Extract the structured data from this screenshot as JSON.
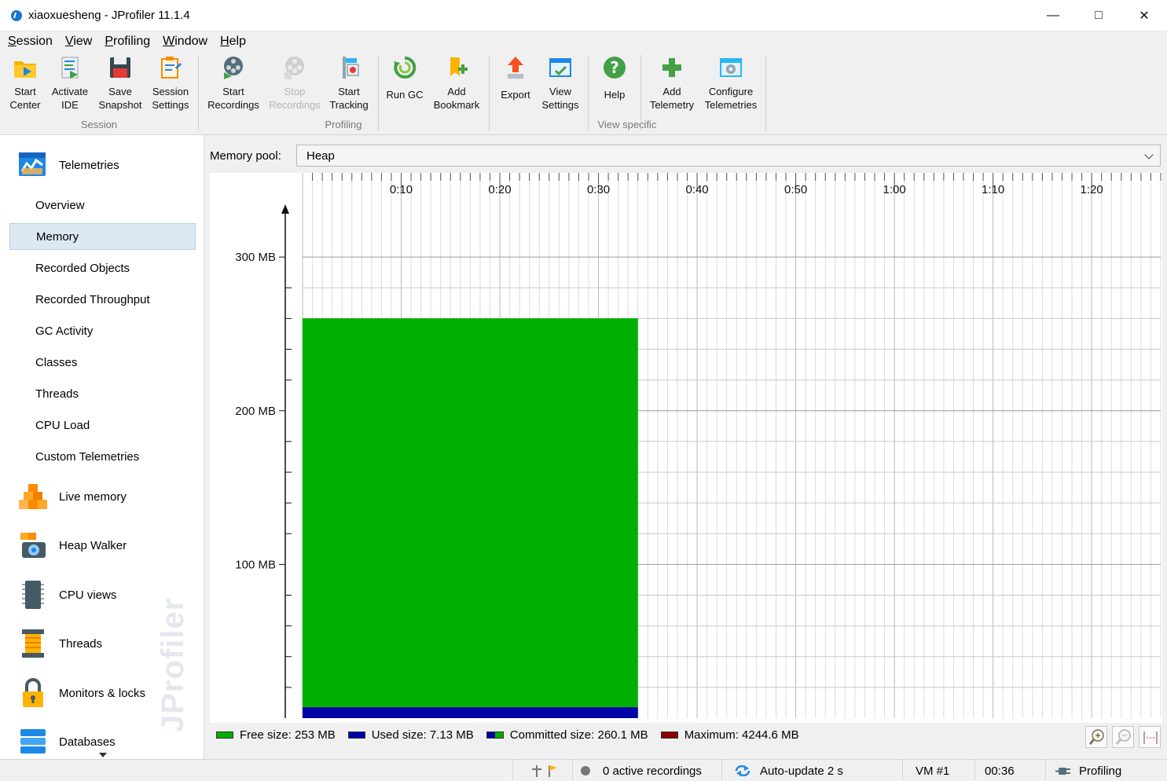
{
  "window": {
    "title": "xiaoxuesheng - JProfiler 11.1.4",
    "controls": {
      "minimize": "—",
      "maximize": "□",
      "close": "✕"
    }
  },
  "menu": {
    "items": [
      {
        "label": "Session",
        "mnemonic": "S",
        "rest": "ession"
      },
      {
        "label": "View",
        "mnemonic": "V",
        "rest": "iew"
      },
      {
        "label": "Profiling",
        "mnemonic": "P",
        "rest": "rofiling"
      },
      {
        "label": "Window",
        "mnemonic": "W",
        "rest": "indow"
      },
      {
        "label": "Help",
        "mnemonic": "H",
        "rest": "elp"
      }
    ]
  },
  "toolbar": {
    "groups": [
      {
        "caption": "Session"
      },
      {
        "caption": "Profiling"
      },
      {
        "caption": "View specific"
      }
    ],
    "buttons": [
      {
        "label": "Start\nCenter",
        "icon": "folder-start-icon"
      },
      {
        "label": "Activate\nIDE",
        "icon": "ide-icon"
      },
      {
        "label": "Save\nSnapshot",
        "icon": "floppy-icon"
      },
      {
        "label": "Session\nSettings",
        "icon": "clipboard-settings-icon"
      },
      {
        "label": "Start\nRecordings",
        "icon": "film-reel-icon"
      },
      {
        "label": "Stop\nRecordings",
        "icon": "film-reel-disabled-icon",
        "disabled": true
      },
      {
        "label": "Start\nTracking",
        "icon": "tracking-icon"
      },
      {
        "label": "Run GC",
        "icon": "recycle-icon"
      },
      {
        "label": "Add\nBookmark",
        "icon": "bookmark-add-icon"
      },
      {
        "label": "Export",
        "icon": "export-arrow-icon"
      },
      {
        "label": "View\nSettings",
        "icon": "view-settings-icon"
      },
      {
        "label": "Help",
        "icon": "help-question-icon"
      },
      {
        "label": "Add\nTelemetry",
        "icon": "plus-icon"
      },
      {
        "label": "Configure\nTelemetries",
        "icon": "configure-gear-icon"
      }
    ]
  },
  "sidebar": {
    "telemetries": {
      "label": "Telemetries",
      "icon": "telemetry-chart-icon"
    },
    "sub_items": [
      {
        "label": "Overview"
      },
      {
        "label": "Memory",
        "selected": true
      },
      {
        "label": "Recorded Objects"
      },
      {
        "label": "Recorded Throughput"
      },
      {
        "label": "GC Activity"
      },
      {
        "label": "Classes"
      },
      {
        "label": "Threads"
      },
      {
        "label": "CPU Load"
      },
      {
        "label": "Custom Telemetries"
      }
    ],
    "sections": [
      {
        "label": "Live memory",
        "icon": "cubes-icon"
      },
      {
        "label": "Heap Walker",
        "icon": "camera-cubes-icon"
      },
      {
        "label": "CPU views",
        "icon": "chip-icon"
      },
      {
        "label": "Threads",
        "icon": "spool-icon"
      },
      {
        "label": "Monitors & locks",
        "icon": "padlock-icon"
      },
      {
        "label": "Databases",
        "icon": "database-icon"
      }
    ],
    "watermark": "JProfiler"
  },
  "main": {
    "memory_pool_label": "Memory pool:",
    "memory_pool_value": "Heap"
  },
  "chart_data": {
    "type": "area",
    "title": "",
    "xlabel": "",
    "ylabel": "",
    "x_ticks": [
      "0:10",
      "0:20",
      "0:30",
      "0:40",
      "0:50",
      "1:00",
      "1:10",
      "1:20"
    ],
    "x_tick_seconds": [
      10,
      20,
      30,
      40,
      50,
      60,
      70,
      80
    ],
    "xlim_seconds": [
      0,
      87
    ],
    "y_ticks": [
      "300 MB",
      "200 MB",
      "100 MB"
    ],
    "y_tick_values_mb": [
      300,
      200,
      100
    ],
    "ylim_mb": [
      0,
      320
    ],
    "data_end_seconds": 34,
    "stacked": true,
    "series": [
      {
        "name": "Used size",
        "value_mb": 7.13,
        "color": "#0000a8"
      },
      {
        "name": "Free size",
        "value_mb": 253,
        "color": "#00b000"
      }
    ],
    "grid": true
  },
  "legend": {
    "items": [
      {
        "label": "Free size: 253 MB",
        "color": "#00b000"
      },
      {
        "label": "Used size: 7.13 MB",
        "color": "#0000a8"
      },
      {
        "label": "Committed size: 260.1 MB",
        "color": "#0000a8",
        "color2": "#00b000"
      },
      {
        "label": "Maximum: 4244.6 MB",
        "color": "#8b0000"
      }
    ]
  },
  "zoom": [
    {
      "icon": "zoom-in-icon"
    },
    {
      "icon": "zoom-out-icon"
    },
    {
      "icon": "fit-width-icon"
    }
  ],
  "statusbar": {
    "recordings": "0 active recordings",
    "autoupdate": "Auto-update 2 s",
    "vm": "VM #1",
    "elapsed": "00:36",
    "mode": "Profiling"
  },
  "colors": {
    "accent": "#1976d2",
    "free": "#00b000",
    "used": "#0000a8",
    "maximum": "#8b0000",
    "selection": "#dde8f5"
  }
}
